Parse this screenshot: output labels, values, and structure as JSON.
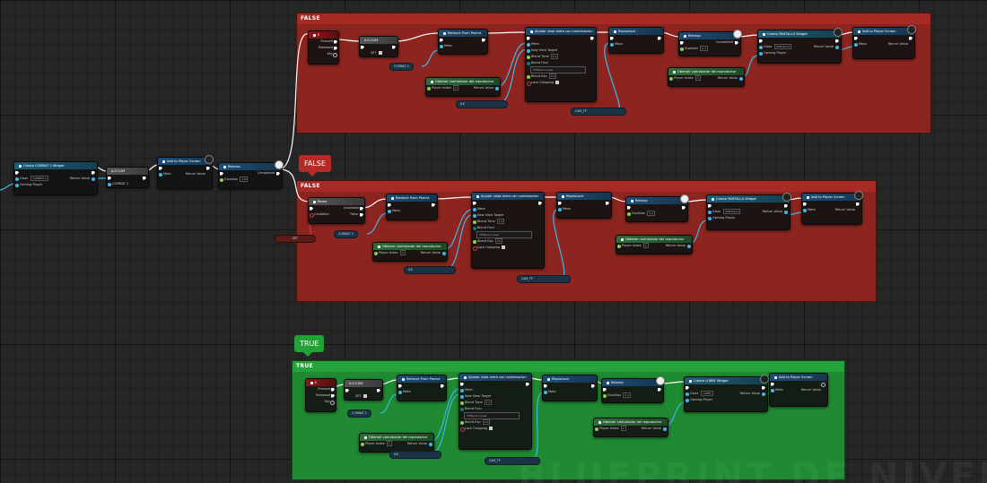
{
  "comments": {
    "top_false": "FALSE",
    "mid_false": "FALSE",
    "bottom_true": "TRUE"
  },
  "bubbles": {
    "mid_false": "FALSE",
    "bottom_true": "TRUE"
  },
  "nodes": {
    "create_combat_widget": {
      "title": "Create COMBAT 2 Widget",
      "class_label": "Class",
      "class_value": "COMBAT 2",
      "return_label": "Return Value",
      "owning": "Owning Player"
    },
    "assign_combat": {
      "title": "A.S.COM",
      "value_label": "COMBAT 2"
    },
    "add_viewport_left": {
      "title": "Add to Player Screen",
      "target": "Meta",
      "return_label": "Return Value"
    },
    "retraso_left": {
      "title": "Retraso",
      "completed": "Completed",
      "duration": "Duration",
      "duration_val": "2.0"
    },
    "pressed_released": {
      "title": "E",
      "pressed": "Pressed",
      "released": "Released",
      "key": "Key"
    },
    "assign_top": {
      "title": "A.S.COM",
      "set": "SET"
    },
    "remove_parent": {
      "title": "Remove From Parent",
      "target": "Meta"
    },
    "set_view_target": {
      "title": "Ajustar vista meta con combinacion",
      "target": "Meta",
      "new_view": "New View Target",
      "blend_time": "Blend Time",
      "blend_func": "Blend Func",
      "blend_func_val": "VTBlend Linear",
      "blend_exp": "Blend Exp",
      "lock_outgoing": "Lock Outgoing"
    },
    "reproducir": {
      "title": "Reproducir",
      "target": "Meta"
    },
    "retraso": {
      "title": "Retraso",
      "completed": "Completed",
      "duration": "Duration",
      "duration_val": "0.2"
    },
    "create_pausa": {
      "title": "Create PANTALLA Widget",
      "class_label": "Class",
      "class_value": "PANTALLA",
      "return_label": "Return Value",
      "owning": "Owning Player"
    },
    "add_viewport": {
      "title": "Add to Player Screen",
      "target": "Meta",
      "return_label": "Return Value"
    },
    "get_player_ctrl": {
      "title": "Obtener controlador del reproductor",
      "index": "Player Index",
      "index_val": "0",
      "return_label": "Return Value"
    },
    "branch": {
      "title": "Rama",
      "condition": "Condition",
      "false_label": "False",
      "true_label": "Invalidate"
    },
    "create_lobby": {
      "title": "Create LOBBY Widget",
      "class_label": "Class",
      "class_value": "LOBBY",
      "return_label": "Return Value",
      "owning": "Owning Player"
    }
  },
  "reroutes": {
    "combat_top": "COMBAT 2",
    "cam_top_a": "ILE",
    "cam_top_b": "CAM_TP",
    "set_mid": "SET",
    "combat_mid": "COMBAT 2",
    "cam_mid_a": "ILE",
    "cam_mid_b": "CAM_TP",
    "combat_bot": "COMBAT 2",
    "cam_bot_a": "ILE",
    "cam_bot_b": "CAM_TP"
  },
  "watermark": "BLUEPRINT DE NIVEL",
  "colors": {
    "red_comment": "#8c2520",
    "green_comment": "#1f8a32",
    "exec_wire": "#ffffff",
    "data_wire": "#2b92e4",
    "obj_wire": "#3db7e8"
  }
}
